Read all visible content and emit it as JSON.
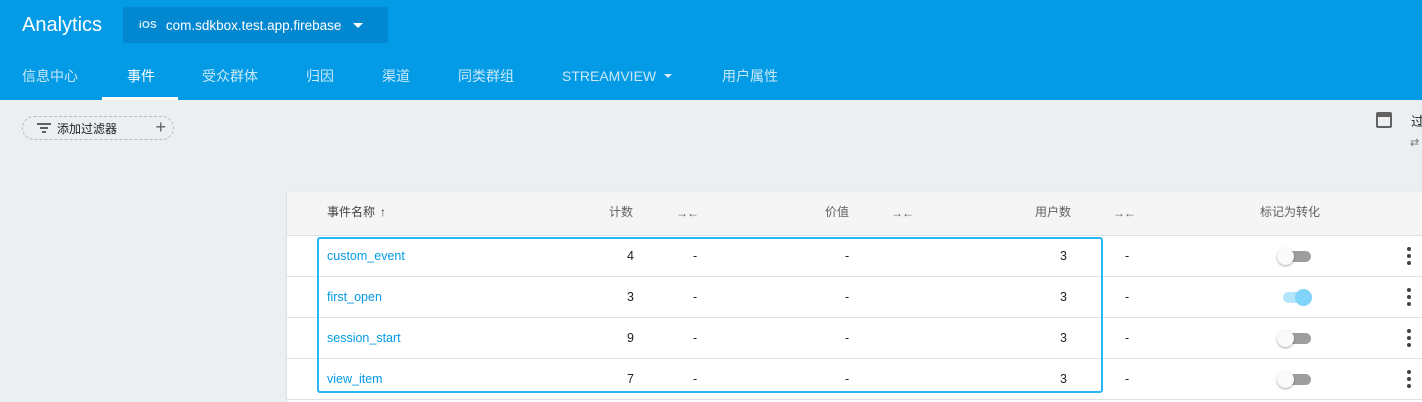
{
  "header": {
    "app_title": "Analytics",
    "platform_badge": "iOS",
    "project_name": "com.sdkbox.test.app.firebase"
  },
  "tabs": [
    {
      "label": "信息中心"
    },
    {
      "label": "事件"
    },
    {
      "label": "受众群体"
    },
    {
      "label": "归因"
    },
    {
      "label": "渠道"
    },
    {
      "label": "同类群组"
    },
    {
      "label": "STREAMVIEW"
    },
    {
      "label": "用户属性"
    }
  ],
  "active_tab": "事件",
  "filter": {
    "label": "添加过滤器"
  },
  "date_range": {
    "label": "过",
    "compare_icon": "compare-arrows-icon"
  },
  "table": {
    "columns": {
      "event_name": "事件名称",
      "count": "计数",
      "value": "价值",
      "users": "用户数",
      "mark_conversion": "标记为转化"
    },
    "rows": [
      {
        "name": "custom_event",
        "count": "4",
        "count_change": "-",
        "value": "-",
        "users": "3",
        "users_change": "-",
        "conversion": false
      },
      {
        "name": "first_open",
        "count": "3",
        "count_change": "-",
        "value": "-",
        "users": "3",
        "users_change": "-",
        "conversion": true
      },
      {
        "name": "session_start",
        "count": "9",
        "count_change": "-",
        "value": "-",
        "users": "3",
        "users_change": "-",
        "conversion": false
      },
      {
        "name": "view_item",
        "count": "7",
        "count_change": "-",
        "value": "-",
        "users": "3",
        "users_change": "-",
        "conversion": false
      }
    ]
  },
  "colors": {
    "header_bg": "#039be5",
    "accent": "#039be5",
    "highlight_border": "#29b6f6",
    "page_bg": "#eceff1"
  }
}
